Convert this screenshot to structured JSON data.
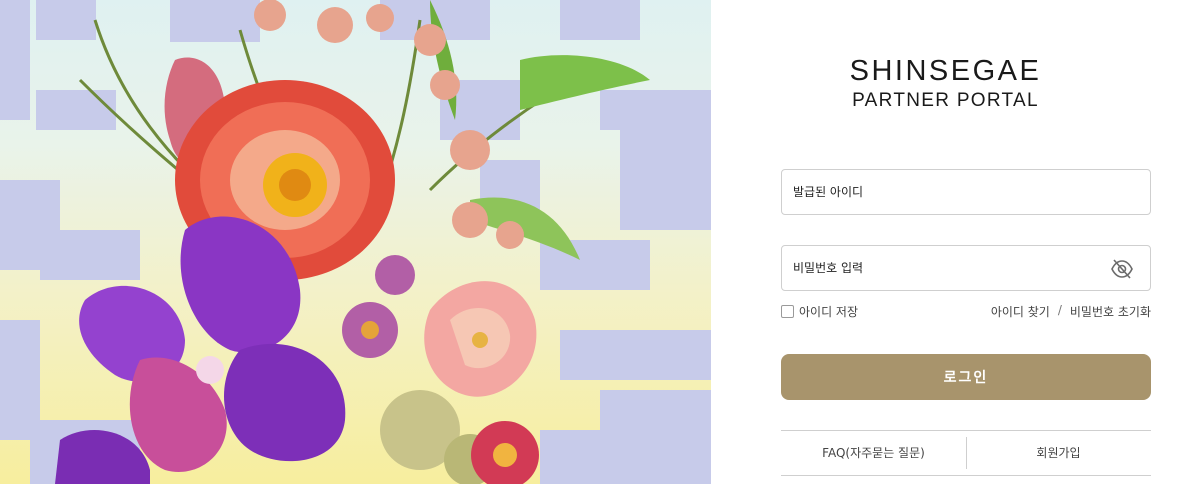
{
  "brand": {
    "line1": "SHINSEGAE",
    "line2": "PARTNER PORTAL"
  },
  "form": {
    "id_placeholder": "발급된 아이디",
    "pw_placeholder": "비밀번호 입력",
    "remember_label": "아이디 저장",
    "find_id": "아이디 찾기",
    "separator": "/",
    "reset_pw": "비밀번호 초기화",
    "login_label": "로그인"
  },
  "footer_links": {
    "faq": "FAQ(자주묻는 질문)",
    "signup": "회원가입"
  },
  "icons": {
    "password_toggle": "eye-off-icon",
    "remember_checkbox": "checkbox-unchecked"
  },
  "colors": {
    "accent": "#a8946c",
    "hero_pattern": "#c7cbea",
    "border": "#cfcfcf"
  }
}
